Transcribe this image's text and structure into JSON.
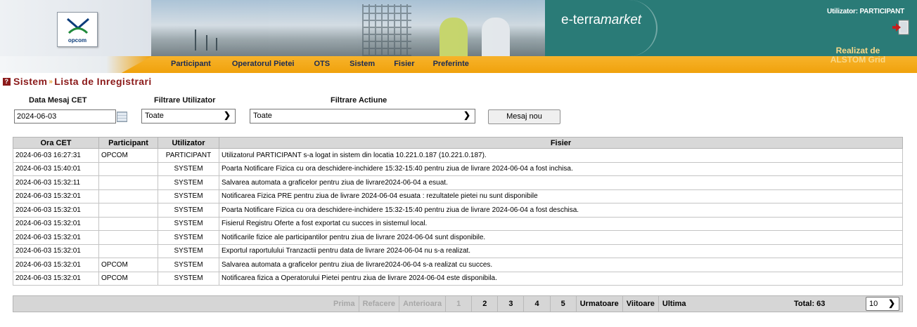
{
  "header": {
    "logo_text": "opcom",
    "brand_prefix": "e-terra",
    "brand_suffix": "market",
    "user_label": "Utilizator: PARTICIPANT",
    "credit_line1": "Realizat de",
    "credit_line2": "ALSTOM Grid",
    "menu": [
      "Participant",
      "Operatorul Pietei",
      "OTS",
      "Sistem",
      "Fisier",
      "Preferinte"
    ]
  },
  "breadcrumb": {
    "section": "Sistem",
    "separator": "»",
    "page": "Lista de Inregistrari"
  },
  "filters": {
    "date_label": "Data Mesaj CET",
    "date_value": "2024-06-03",
    "user_filter_label": "Filtrare Utilizator",
    "user_filter_value": "Toate",
    "action_filter_label": "Filtrare Actiune",
    "action_filter_value": "Toate",
    "new_message_button": "Mesaj nou"
  },
  "table": {
    "columns": [
      "Ora CET",
      "Participant",
      "Utilizator",
      "Fisier"
    ],
    "rows": [
      [
        "2024-06-03 16:27:31",
        "OPCOM",
        "PARTICIPANT",
        "Utilizatorul PARTICIPANT s-a logat in sistem din locatia 10.221.0.187 (10.221.0.187)."
      ],
      [
        "2024-06-03 15:40:01",
        "",
        "SYSTEM",
        "Poarta Notificare Fizica cu ora deschidere-inchidere 15:32-15:40 pentru ziua de livrare 2024-06-04 a fost inchisa."
      ],
      [
        "2024-06-03 15:32:11",
        "",
        "SYSTEM",
        "Salvarea automata a graficelor pentru ziua de livrare2024-06-04 a esuat."
      ],
      [
        "2024-06-03 15:32:01",
        "",
        "SYSTEM",
        "Notificarea Fizica PRE pentru ziua de livrare 2024-06-04 esuata : rezultatele pietei nu sunt disponibile"
      ],
      [
        "2024-06-03 15:32:01",
        "",
        "SYSTEM",
        "Poarta Notificare Fizica cu ora deschidere-inchidere 15:32-15:40 pentru ziua de livrare 2024-06-04 a fost deschisa."
      ],
      [
        "2024-06-03 15:32:01",
        "",
        "SYSTEM",
        "Fisierul Registru Oferte a fost exportat cu succes in sistemul local."
      ],
      [
        "2024-06-03 15:32:01",
        "",
        "SYSTEM",
        "Notificarile fizice ale participantilor pentru ziua de livrare 2024-06-04 sunt disponibile."
      ],
      [
        "2024-06-03 15:32:01",
        "",
        "SYSTEM",
        "Exportul raportulului Tranzactii pentru data de livrare 2024-06-04 nu s-a realizat."
      ],
      [
        "2024-06-03 15:32:01",
        "OPCOM",
        "SYSTEM",
        "Salvarea automata a graficelor pentru ziua de livrare2024-06-04 s-a realizat cu succes."
      ],
      [
        "2024-06-03 15:32:01",
        "OPCOM",
        "SYSTEM",
        "Notificarea fizica a Operatorului Pietei pentru ziua de livrare 2024-06-04 este disponibila."
      ]
    ]
  },
  "pager": {
    "first": "Prima",
    "refresh": "Refacere",
    "previous": "Anterioara",
    "pages": [
      "1",
      "2",
      "3",
      "4",
      "5"
    ],
    "next": "Urmatoare",
    "following": "Viitoare",
    "last": "Ultima",
    "total_label": "Total: 63",
    "page_size": "10"
  },
  "colors": {
    "accent": "#f0a20c",
    "title": "#8b1a1a",
    "teal": "#2a7b77"
  }
}
